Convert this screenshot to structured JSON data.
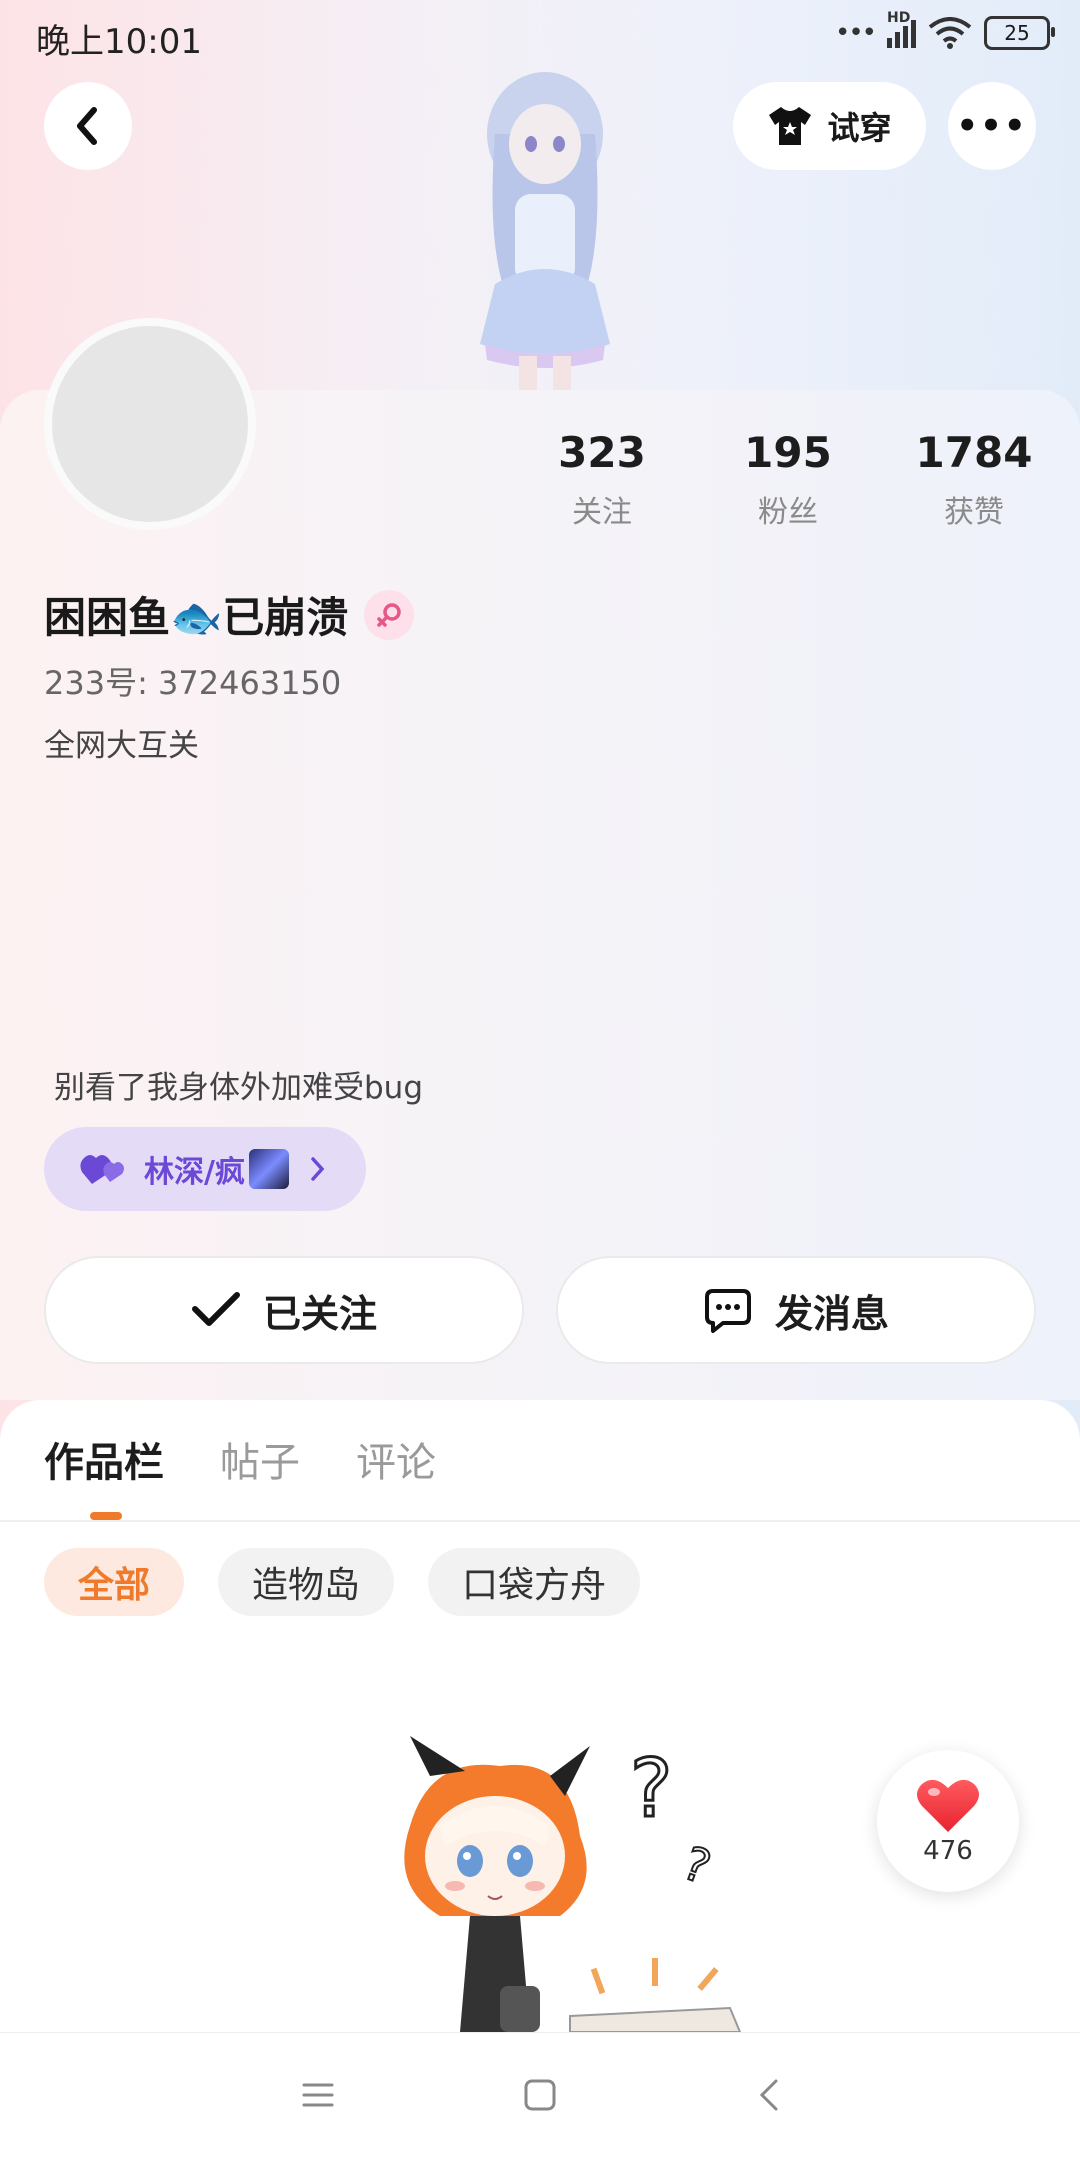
{
  "status_bar": {
    "time": "晚上10:01",
    "battery": "25",
    "network": "HD"
  },
  "header": {
    "try_on_label": "试穿"
  },
  "stats": [
    {
      "value": "323",
      "label": "关注"
    },
    {
      "value": "195",
      "label": "粉丝"
    },
    {
      "value": "1784",
      "label": "获赞"
    }
  ],
  "profile": {
    "nickname_part1": "困困鱼",
    "nickname_part2": "已崩溃",
    "uid": "233号: 372463150",
    "bio_line1": "全网大互关",
    "bio_line2": "别看了我身体外加难受bug",
    "tag_label": "林深/疯"
  },
  "actions": {
    "follow_label": "已关注",
    "message_label": "发消息"
  },
  "tabs": [
    {
      "label": "作品栏",
      "active": true
    },
    {
      "label": "帖子",
      "active": false
    },
    {
      "label": "评论",
      "active": false
    }
  ],
  "filters": [
    {
      "label": "全部",
      "active": true
    },
    {
      "label": "造物岛",
      "active": false
    },
    {
      "label": "口袋方舟",
      "active": false
    }
  ],
  "like_float": {
    "count": "476"
  },
  "colors": {
    "accent": "#f07a2c",
    "tag_text": "#6b48d6",
    "tag_bg": "#e4dcf7"
  }
}
